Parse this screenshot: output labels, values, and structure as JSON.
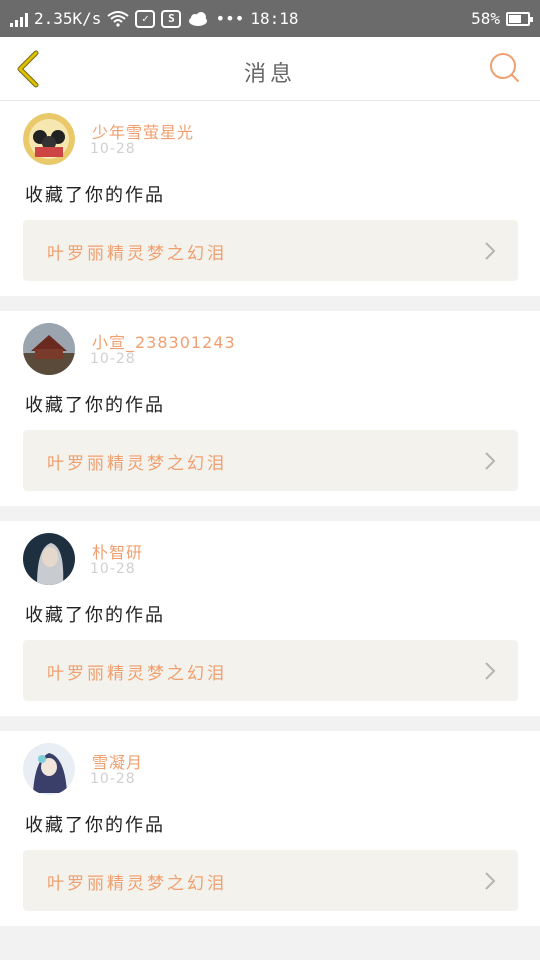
{
  "status_bar": {
    "net_speed": "2.35K/s",
    "time": "18:18",
    "battery": "58%",
    "battery_level": 0.58,
    "icons": [
      "signal-icon",
      "wifi-icon",
      "message-check-icon",
      "s-app-icon",
      "cloud-icon",
      "more-dots-icon",
      "battery-icon"
    ]
  },
  "header": {
    "title": "消息",
    "back_icon": "chevron-left-icon",
    "search_icon": "search-icon",
    "accent": "#f0a070",
    "back_color": "#e0c000"
  },
  "notifications": [
    {
      "user": "少年雪萤星光",
      "time": "10-28",
      "action": "收藏了你的作品",
      "work": "叶罗丽精灵梦之幻泪"
    },
    {
      "user": "小宣_238301243",
      "time": "10-28",
      "action": "收藏了你的作品",
      "work": "叶罗丽精灵梦之幻泪"
    },
    {
      "user": "朴智研",
      "time": "10-28",
      "action": "收藏了你的作品",
      "work": "叶罗丽精灵梦之幻泪"
    },
    {
      "user": "雪凝月",
      "time": "10-28",
      "action": "收藏了你的作品",
      "work": "叶罗丽精灵梦之幻泪"
    }
  ]
}
